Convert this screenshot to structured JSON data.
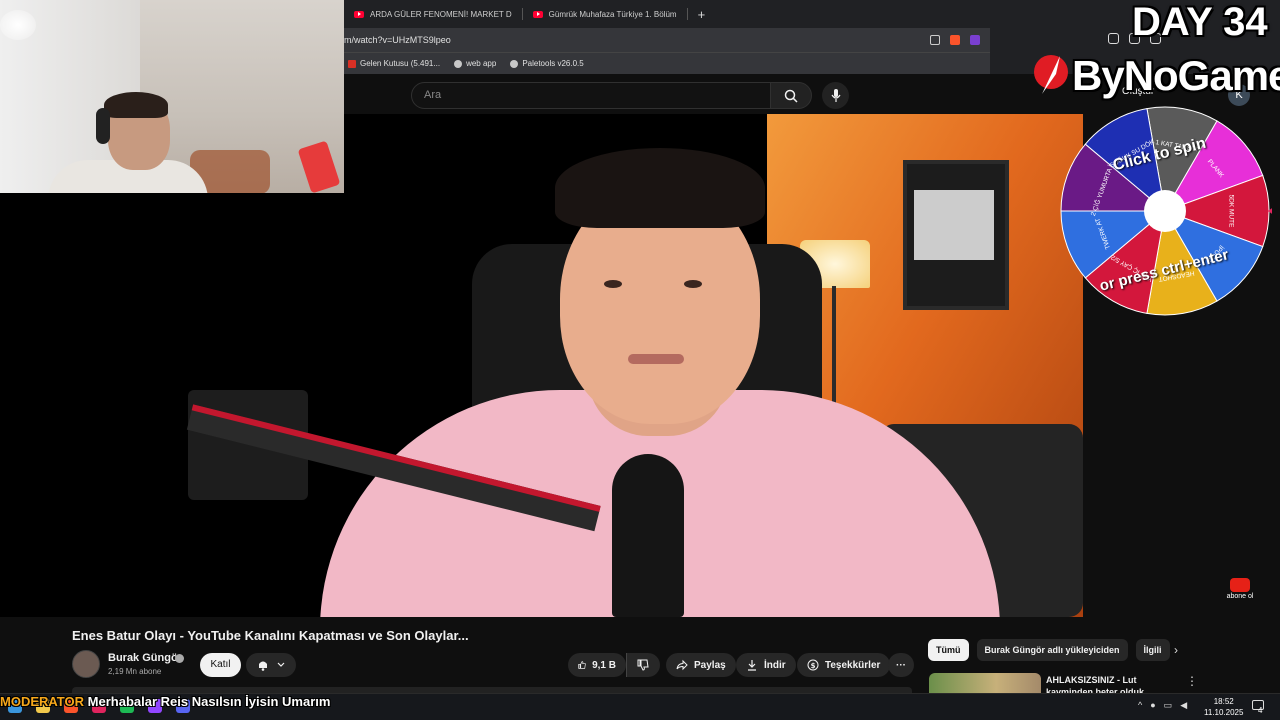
{
  "browser": {
    "tabs": [
      {
        "label": "ARDA GÜLER FENOMENİ! MARKET D"
      },
      {
        "label": "Gümrük Muhafaza Türkiye 1. Bölüm"
      }
    ],
    "new_tab": "+",
    "address": "m/watch?v=UHzMTS9lpeo",
    "bookmarks": [
      {
        "label": "Gelen Kutusu (5.491..."
      },
      {
        "label": "web app"
      },
      {
        "label": "Paletools v26.0.5"
      }
    ]
  },
  "youtube": {
    "search_placeholder": "Ara",
    "create_label": "Oluştur",
    "avatar_letter": "K",
    "video_title": "Enes Batur Olayı - YouTube Kanalını Kapatması ve Son Olaylar...",
    "channel_name": "Burak Güngör",
    "channel_subs": "2,19 Mn abone",
    "join_label": "Katıl",
    "like_count": "9,1 B",
    "share_label": "Paylaş",
    "download_label": "İndir",
    "thanks_label": "Teşekkürler",
    "more_label": "···",
    "chips": [
      {
        "label": "Tümü",
        "active": true
      },
      {
        "label": "Burak Güngör adlı yükleyiciden",
        "active": false
      },
      {
        "label": "İlgili",
        "active": false
      }
    ],
    "rec_title": "AHLAKSIZSINIZ - Lut kavminden beter olduk",
    "abone_label": "abone ol"
  },
  "overlay": {
    "day": "DAY 34",
    "brand": "ByNoGame",
    "wheel_line1": "Click to spin",
    "wheel_line2": "or press ctrl+enter",
    "wheel_segments": [
      {
        "label": "1 KAT TAHSİN",
        "color": "#5a5a5a"
      },
      {
        "label": "PLANK",
        "color": "#e72fd8"
      },
      {
        "label": "5DK MUTE",
        "color": "#d3173c"
      },
      {
        "label": "İPUCU",
        "color": "#2f6fe0"
      },
      {
        "label": "HEADSHOT",
        "color": "#e8b11b"
      },
      {
        "label": "YAĞ İÇ ÇAY 5/2",
        "color": "#d3173c"
      },
      {
        "label": "TWERK AT",
        "color": "#2f6fe0"
      },
      {
        "label": "2 ÇİĞ YUMURTA İÇ",
        "color": "#6a1a86"
      },
      {
        "label": "SOĞUK SU DÖK",
        "color": "#1e2fb3"
      }
    ]
  },
  "chat": {
    "role": "MODERATOR",
    "message": "Merhabalar Reis Nasılsın İyisin Umarım"
  },
  "taskbar": {
    "time": "18:52",
    "date": "11.10.2025",
    "notif_count": "4"
  }
}
